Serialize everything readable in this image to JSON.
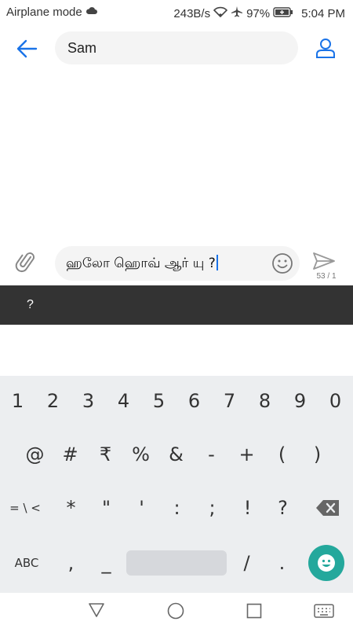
{
  "status_bar": {
    "left_text": "Airplane mode",
    "speed": "243B/s",
    "battery_pct": "97%",
    "time": "5:04 PM",
    "icons": [
      "cloud-icon",
      "wifi-icon",
      "airplane-icon",
      "battery-icon"
    ]
  },
  "header": {
    "contact_name": "Sam",
    "icons": [
      "back-arrow-icon",
      "contact-icon"
    ],
    "accent": "#1a73e8"
  },
  "compose": {
    "message_text": "ஹலோ ஹொவ் ஆர் யு ?",
    "char_counter": "53 / 1",
    "icons": [
      "attach-icon",
      "emoji-icon",
      "send-icon"
    ]
  },
  "suggestion_bar": {
    "suggestion": "?"
  },
  "keyboard": {
    "row1": [
      "1",
      "2",
      "3",
      "4",
      "5",
      "6",
      "7",
      "8",
      "9",
      "0"
    ],
    "row2": [
      "@",
      "#",
      "₹",
      "%",
      "&",
      "-",
      "+",
      "(",
      ")"
    ],
    "row3": [
      "= \\ <",
      "*",
      "\"",
      "'",
      ":",
      ";",
      "!",
      "?"
    ],
    "row4": [
      "ABC",
      ",",
      "_",
      "/",
      "."
    ],
    "icons": [
      "backspace-icon",
      "emoji-face-icon"
    ],
    "emoji_button_color": "#24a89c"
  },
  "nav_bar": {
    "icons": [
      "back-triangle-icon",
      "home-circle-icon",
      "recents-square-icon",
      "keyboard-switch-icon"
    ]
  }
}
